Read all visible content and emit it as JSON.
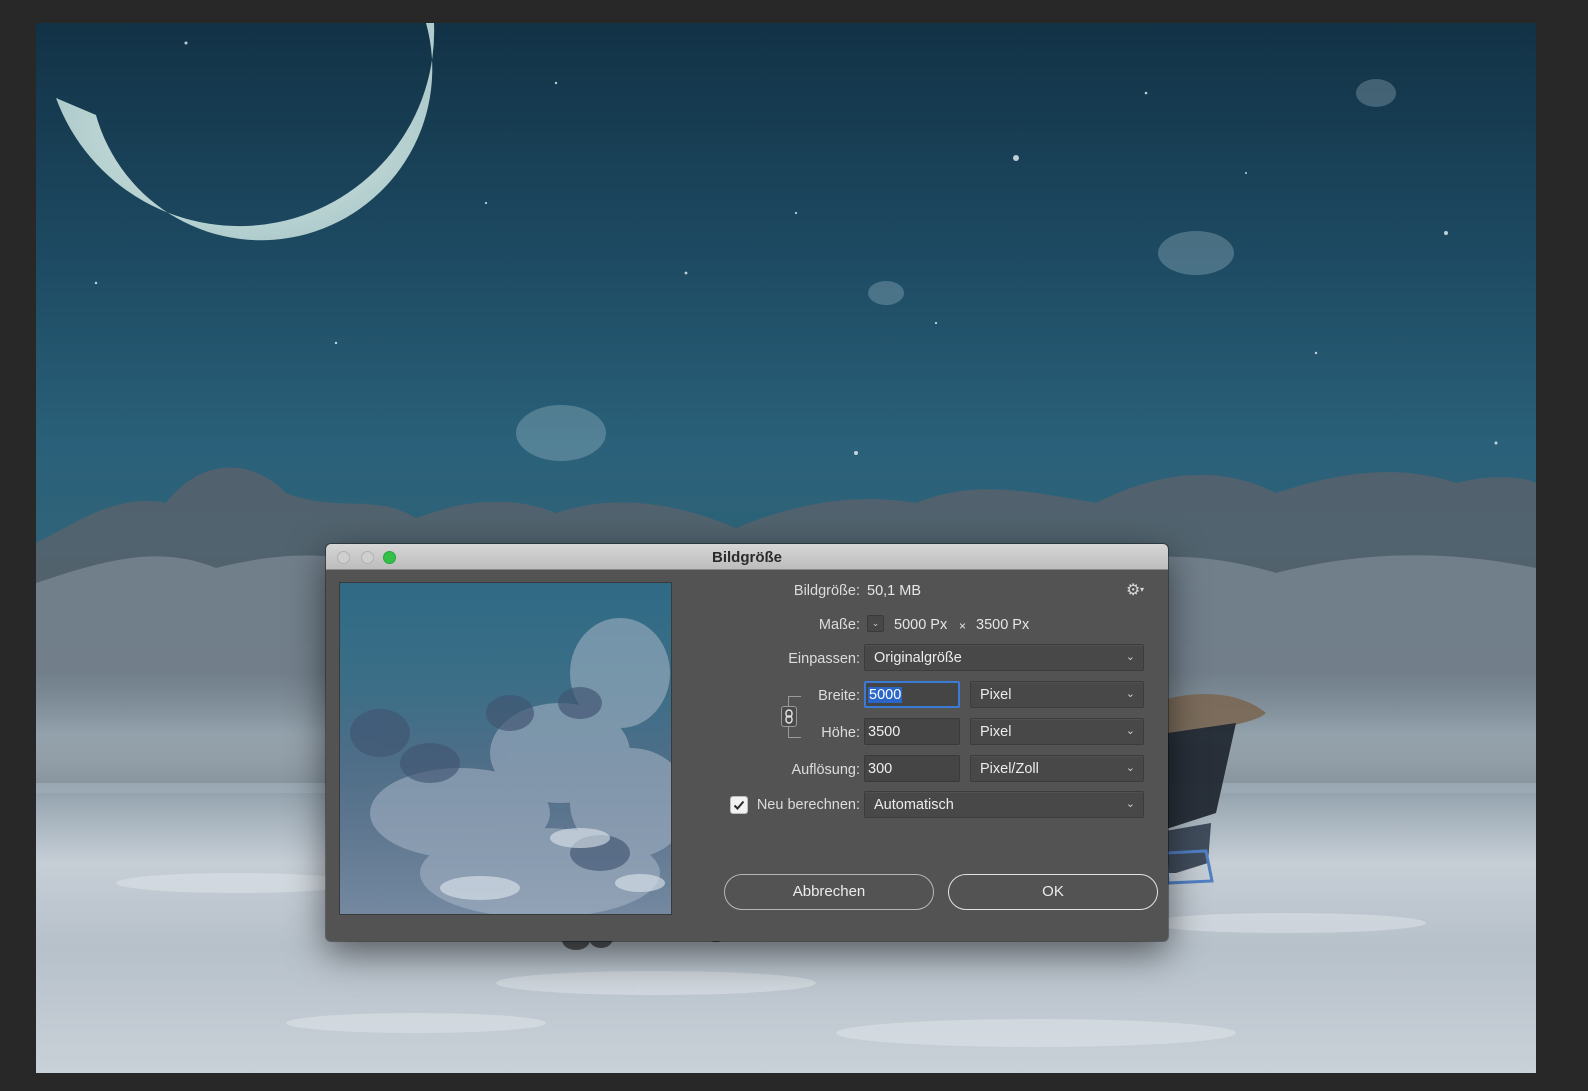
{
  "dialog": {
    "title": "Bildgröße",
    "bildgroesse_label": "Bildgröße:",
    "bildgroesse_value": "50,1 MB",
    "masse_label": "Maße:",
    "masse_width": "5000 Px",
    "masse_times": "×",
    "masse_height": "3500 Px",
    "einpassen_label": "Einpassen:",
    "einpassen_value": "Originalgröße",
    "breite_label": "Breite:",
    "breite_value": "5000",
    "breite_unit": "Pixel",
    "hoehe_label": "Höhe:",
    "hoehe_value": "3500",
    "hoehe_unit": "Pixel",
    "aufloesung_label": "Auflösung:",
    "aufloesung_value": "300",
    "aufloesung_unit": "Pixel/Zoll",
    "neuberechnen_label": "Neu berechnen:",
    "neuberechnen_checked": true,
    "neuberechnen_value": "Automatisch",
    "cancel_label": "Abbrechen",
    "ok_label": "OK"
  },
  "icons": {
    "chevron": "⌄",
    "gear": "⚙",
    "gear_arrow": "▾"
  },
  "colors": {
    "dialog_bg": "#535353",
    "focus_blue": "#2a66c8",
    "zoom_button_green": "#31c048"
  }
}
